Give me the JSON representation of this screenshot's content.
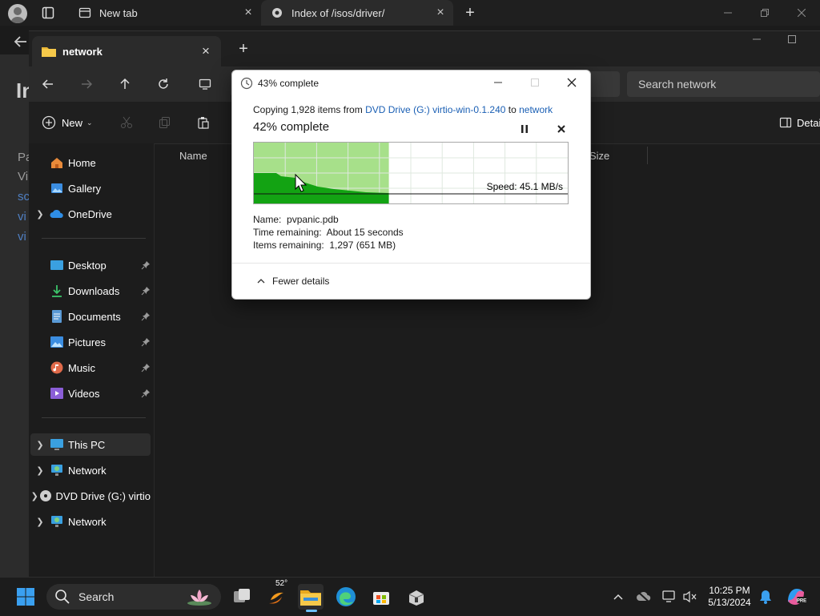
{
  "browser": {
    "tabs": [
      {
        "label": "New tab"
      },
      {
        "label": "Index of /isos/driver/"
      }
    ],
    "page_text": [
      "In",
      "Pa",
      "Vi",
      "sc",
      "vi",
      "vi"
    ]
  },
  "explorer": {
    "tab_label": "network",
    "search_placeholder": "Search network",
    "new_label": "New",
    "details_label": "Detai",
    "columns": {
      "name": "Name",
      "size": "Size"
    },
    "sidebar": {
      "home": "Home",
      "gallery": "Gallery",
      "onedrive": "OneDrive",
      "desktop": "Desktop",
      "downloads": "Downloads",
      "documents": "Documents",
      "pictures": "Pictures",
      "music": "Music",
      "videos": "Videos",
      "this_pc": "This PC",
      "network1": "Network",
      "dvd": "DVD Drive (G:) virtio",
      "network2": "Network"
    }
  },
  "dialog": {
    "title": "43% complete",
    "copy_prefix": "Copying 1,928 items from ",
    "source": "DVD Drive (G:) virtio-win-0.1.240",
    "to_word": " to ",
    "destination": "network",
    "percent_text": "42% complete",
    "progress_fraction": 0.43,
    "speed_text": "Speed: 45.1 MB/s",
    "name_label": "Name:",
    "name_value": "pvpanic.pdb",
    "time_label": "Time remaining:",
    "time_value": "About 15 seconds",
    "items_label": "Items remaining:",
    "items_value": "1,297 (651 MB)",
    "fewer_details": "Fewer details",
    "colors": {
      "fill_light": "#a7e08a",
      "fill_dark": "#13a313",
      "link": "#1a5fb4"
    }
  },
  "taskbar": {
    "search_label": "Search",
    "weather_temp": "52°",
    "time": "10:25 PM",
    "date": "5/13/2024"
  }
}
